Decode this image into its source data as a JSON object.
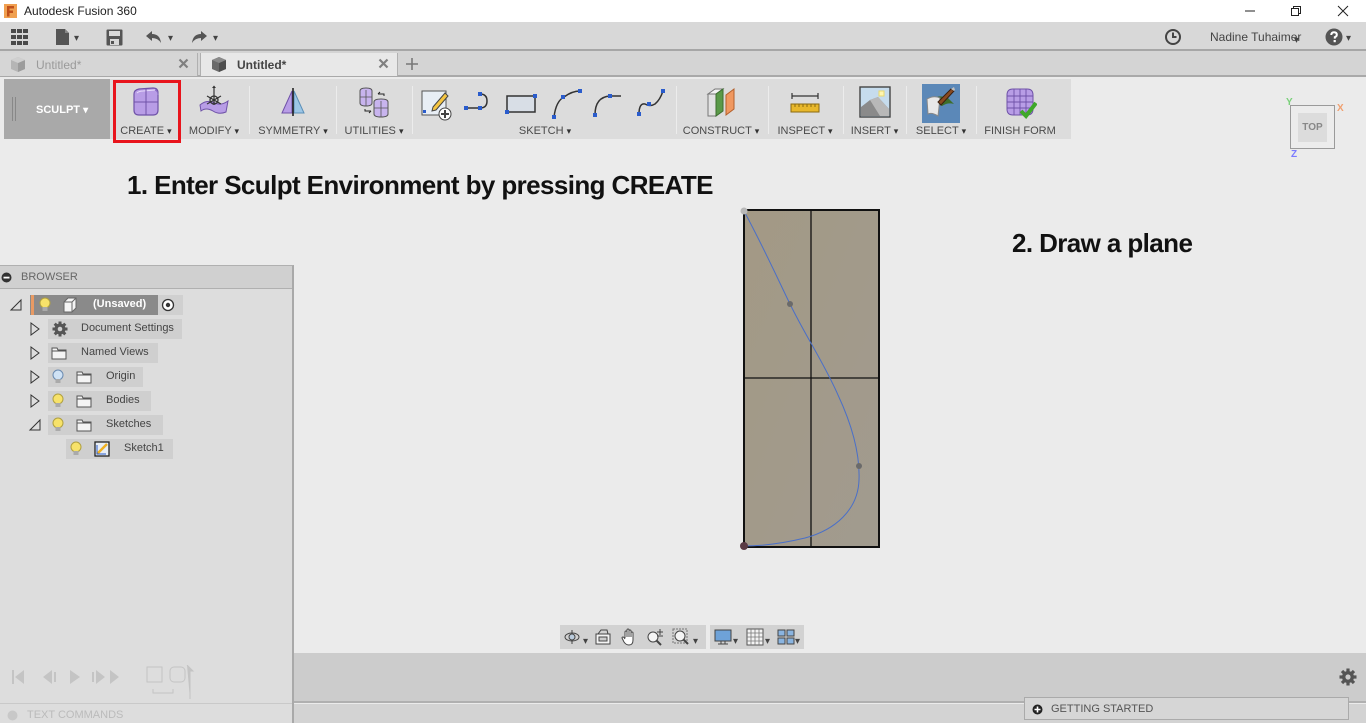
{
  "window": {
    "title": "Autodesk Fusion 360",
    "controls": [
      "minimize",
      "restore",
      "close"
    ]
  },
  "quick_access": {
    "items": [
      {
        "icon": "apps-grid-icon"
      },
      {
        "icon": "file-icon",
        "has_menu": true
      },
      {
        "icon": "save-icon"
      },
      {
        "icon": "undo-icon",
        "has_menu": true
      },
      {
        "icon": "redo-icon",
        "has_menu": true
      }
    ],
    "right": [
      {
        "icon": "job-status-clock-icon"
      },
      {
        "icon": "help-icon",
        "has_menu": true
      }
    ]
  },
  "user": {
    "name": "Nadine Tuhaimer"
  },
  "tabs": [
    {
      "label": "Untitled*",
      "active": false
    },
    {
      "label": "Untitled*",
      "active": true
    }
  ],
  "toolbar": {
    "workspace": "SCULPT",
    "highlight_color": "#e8141c",
    "groups": [
      {
        "label": "CREATE",
        "highlighted": true,
        "has_menu": true
      },
      {
        "label": "MODIFY",
        "has_menu": true
      },
      {
        "label": "SYMMETRY",
        "has_menu": true
      },
      {
        "label": "UTILITIES",
        "has_menu": true
      },
      {
        "label": "SKETCH",
        "has_menu": true,
        "tools": [
          "create-sketch",
          "line-arc",
          "rectangle",
          "three-point-arc",
          "tangent-arc",
          "spline"
        ]
      },
      {
        "label": "CONSTRUCT",
        "has_menu": true
      },
      {
        "label": "INSPECT",
        "has_menu": true
      },
      {
        "label": "INSERT",
        "has_menu": true
      },
      {
        "label": "SELECT",
        "has_menu": true,
        "active": true
      },
      {
        "label": "FINISH FORM",
        "has_menu": false
      }
    ]
  },
  "viewcube": {
    "face": "TOP",
    "axis_x": "X",
    "axis_y": "Y",
    "axis_z": "Z"
  },
  "annotations": {
    "step1": "1. Enter Sculpt Environment by pressing CREATE",
    "step2": "2. Draw a plane"
  },
  "browser": {
    "title": "BROWSER",
    "items": [
      {
        "label": "(Unsaved)",
        "level": 0,
        "expanded": true,
        "icon": "component-icon",
        "visible": true,
        "active": true
      },
      {
        "label": "Document Settings",
        "level": 1,
        "expanded": false,
        "icon": "gear-icon"
      },
      {
        "label": "Named Views",
        "level": 1,
        "expanded": false,
        "icon": "folder-icon"
      },
      {
        "label": "Origin",
        "level": 1,
        "expanded": false,
        "icon": "folder-icon",
        "visible": false
      },
      {
        "label": "Bodies",
        "level": 1,
        "expanded": false,
        "icon": "folder-icon",
        "visible": true
      },
      {
        "label": "Sketches",
        "level": 1,
        "expanded": true,
        "icon": "folder-icon",
        "visible": true
      },
      {
        "label": "Sketch1",
        "level": 2,
        "icon": "sketch-icon",
        "visible": true
      }
    ]
  },
  "navbar": {
    "tools": [
      "orbit",
      "look-at",
      "pan",
      "zoom",
      "fit",
      "display-settings",
      "grid-settings",
      "viewports"
    ]
  },
  "bottom": {
    "text_commands": "TEXT COMMANDS",
    "getting_started": "GETTING STARTED"
  }
}
